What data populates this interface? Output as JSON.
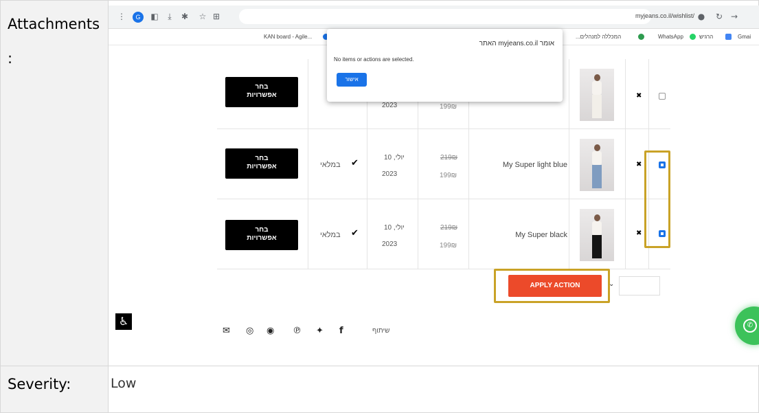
{
  "report": {
    "attachments_label": "Attachments",
    "attachments_colon": ":",
    "severity_label": "Severity:",
    "severity_value": "Low"
  },
  "browser": {
    "url": "myjeans.co.il/wishlist/",
    "bookmarks": [
      "KAN board - Agile...",
      "...המכללה למנהלים",
      "WhatsApp",
      "הרגיש",
      "Gmai"
    ]
  },
  "alert": {
    "title": "האתר myjeans.co.il אומר",
    "message": "No items or actions are selected.",
    "ok_label": "אישור"
  },
  "wishlist": {
    "rows": [
      {
        "choose_label_1": "בחר",
        "choose_label_2": "אפשרויות",
        "stock": "",
        "date_day": "",
        "date_year": "2023",
        "price_old": "",
        "price_new": "199₪",
        "name": "",
        "checked": false
      },
      {
        "choose_label_1": "בחר",
        "choose_label_2": "אפשרויות",
        "stock": "במלאי",
        "date_day": "10 ,יולי",
        "date_year": "2023",
        "price_old": "219₪",
        "price_new": "199₪",
        "name": "My Super light blue",
        "checked": true
      },
      {
        "choose_label_1": "בחר",
        "choose_label_2": "אפשרויות",
        "stock": "במלאי",
        "date_day": "10 ,יולי",
        "date_year": "2023",
        "price_old": "219₪",
        "price_new": "199₪",
        "name": "My Super black",
        "checked": true
      }
    ],
    "apply_label": "APPLY ACTION",
    "share_label": "שיתוף"
  },
  "colors": {
    "highlight": "#c9a227",
    "apply": "#ec4a2a",
    "checkbox": "#1a73e8",
    "whatsapp": "#3cc25a"
  }
}
